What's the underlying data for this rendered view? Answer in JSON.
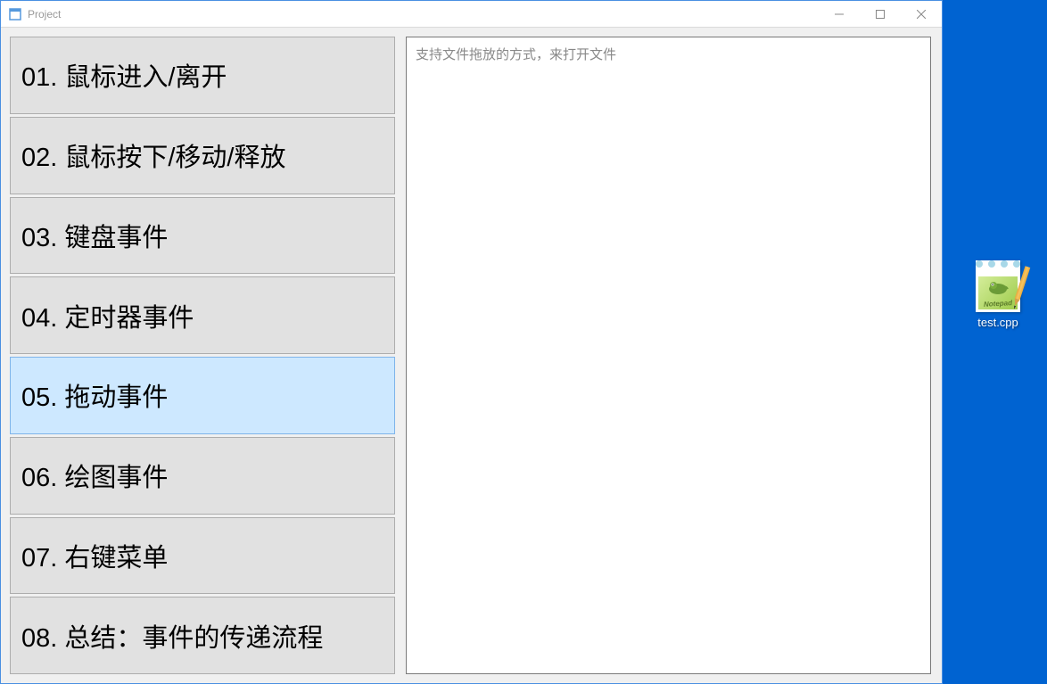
{
  "window": {
    "title": "Project",
    "controls": {
      "minimize": "minimize",
      "maximize": "maximize",
      "close": "close"
    }
  },
  "list": {
    "items": [
      {
        "label": "01. 鼠标进入/离开",
        "selected": false
      },
      {
        "label": "02. 鼠标按下/移动/释放",
        "selected": false
      },
      {
        "label": "03. 键盘事件",
        "selected": false
      },
      {
        "label": "04. 定时器事件",
        "selected": false
      },
      {
        "label": "05. 拖动事件",
        "selected": true
      },
      {
        "label": "06. 绘图事件",
        "selected": false
      },
      {
        "label": "07. 右键菜单",
        "selected": false
      },
      {
        "label": "08. 总结：事件的传递流程",
        "selected": false
      }
    ]
  },
  "textarea": {
    "placeholder": "支持文件拖放的方式，来打开文件"
  },
  "desktop": {
    "file": {
      "name": "test.cpp",
      "iconText": "Notepad"
    }
  }
}
